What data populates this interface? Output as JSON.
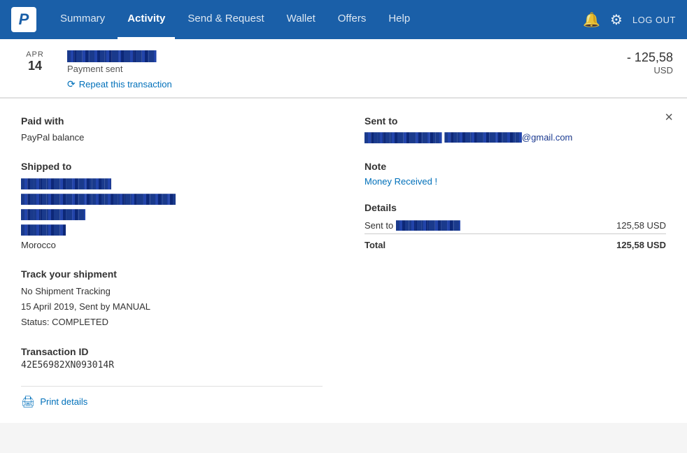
{
  "navbar": {
    "logo_text": "P",
    "links": [
      {
        "label": "Summary",
        "active": false
      },
      {
        "label": "Activity",
        "active": true
      },
      {
        "label": "Send & Request",
        "active": false
      },
      {
        "label": "Wallet",
        "active": false
      },
      {
        "label": "Offers",
        "active": false
      },
      {
        "label": "Help",
        "active": false
      }
    ],
    "logout_label": "LOG OUT",
    "bell_icon": "🔔",
    "gear_icon": "⚙"
  },
  "transaction": {
    "date_month": "APR",
    "date_day": "14",
    "title_redacted": "████████████",
    "status": "Payment sent",
    "repeat_label": "Repeat this transaction",
    "amount": "- 125,58",
    "currency": "USD"
  },
  "detail": {
    "close_label": "×",
    "paid_with_label": "Paid with",
    "paid_with_value": "PayPal balance",
    "shipped_to_label": "Shipped to",
    "address_line1_redacted": "██████████████",
    "address_line2_redacted": "████████████████████████",
    "address_line3_redacted": "██████████",
    "address_line4_redacted": "███████",
    "address_line5": "Morocco",
    "track_label": "Track your shipment",
    "track_line1": "No Shipment Tracking",
    "track_line2": "15 April 2019, Sent by MANUAL",
    "track_line3": "Status: COMPLETED",
    "txn_id_label": "Transaction ID",
    "txn_id_value": "42E56982XN093014R",
    "sent_to_label": "Sent to",
    "sent_to_name_redacted": "████████████",
    "sent_to_email_redacted": "████████████@gmail.com",
    "note_label": "Note",
    "note_value": "Money Received !",
    "details_label": "Details",
    "details_row_label_redacted": "Sent to ██████████",
    "details_row_amount": "125,58 USD",
    "total_label": "Total",
    "total_amount": "125,58 USD",
    "print_label": "Print details"
  }
}
